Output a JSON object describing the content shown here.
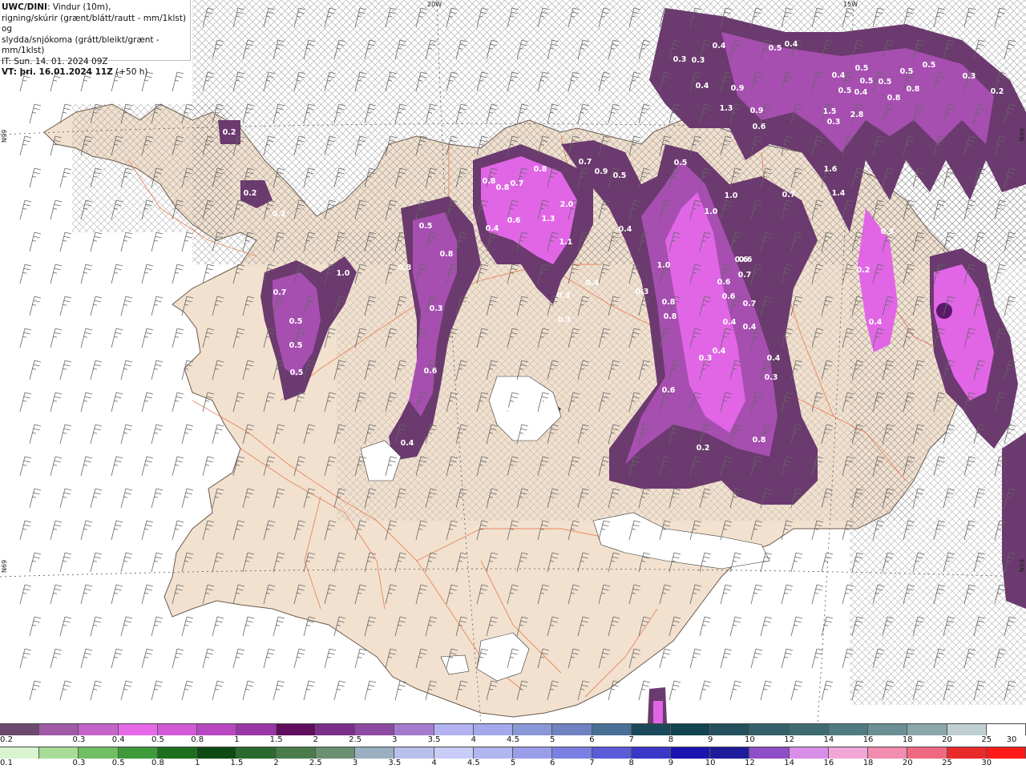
{
  "header": {
    "line1_bold": "UWC/DINI",
    "line1_rest": ": Vindur (10m),",
    "line2": "rigning/skúrir (grænt/blátt/rautt - mm/1klst) og",
    "line3": "slydda/snjókoma (grátt/bleikt/grænt - mm/1klst)",
    "line4": "IT: Sun. 14. 01. 2024 09Z",
    "line5_bold": "VT: þri. 16.01.2024 11Z",
    "line5_rest": " (+50 h)"
  },
  "map": {
    "lon_labels": [
      "20W",
      "15W"
    ],
    "lat_labels": [
      "66N",
      "65N"
    ],
    "side_labels": [
      "N99",
      "N69"
    ],
    "value_labels": [
      "0.2",
      "0.2",
      "0.2",
      "0.7",
      "1.0",
      "0.5",
      "0.5",
      "0.5",
      "0.8",
      "0.3",
      "0.3",
      "0.6",
      "0.4",
      "0.5",
      "0.8",
      "0.8",
      "0.7",
      "0.8",
      "0.6",
      "0.4",
      "1.3",
      "2.0",
      "1.1",
      "0.7",
      "0.9",
      "0.5",
      "0.4",
      "0.4",
      "0.3",
      "0.3",
      "1.0",
      "0.8",
      "0.8",
      "0.6",
      "0.5",
      "1.0",
      "1.0",
      "0.6",
      "0.6",
      "0.7",
      "0.7",
      "0.4",
      "0.4",
      "0.3",
      "0.4",
      "0.3",
      "0.4",
      "0.3",
      "0.6",
      "0.6",
      "0.8",
      "0.2",
      "0.4",
      "0.3",
      "0.3",
      "0.3",
      "0.4",
      "0.4",
      "0.4",
      "0.5",
      "0.4",
      "0.5",
      "0.5",
      "0.5",
      "0.4",
      "0.5",
      "0.5",
      "0.5",
      "0.3",
      "0.8",
      "0.8",
      "0.2",
      "0.9",
      "1.3",
      "0.9",
      "0.6",
      "0.3",
      "1.5",
      "2.8",
      "1.6",
      "1.4",
      "0.7",
      "0.3",
      "0.2",
      "0.4"
    ],
    "colors": {
      "land": "#f2e1cf",
      "sea": "#ffffff",
      "roads": "#e8764a",
      "border": "#d23c3c",
      "snow_dark": "#6b3a6e",
      "snow_mid": "#a64fb0",
      "snow_light": "#e166e6"
    }
  },
  "legend_snow": {
    "labels": [
      "0.2",
      "0.3",
      "0.4",
      "0.5",
      "0.8",
      "1",
      "1.5",
      "2",
      "2.5",
      "3",
      "3.5",
      "4",
      "4.5",
      "5",
      "6",
      "7",
      "8",
      "9",
      "10",
      "12",
      "14",
      "16",
      "18",
      "20",
      "25",
      "30"
    ],
    "colors": [
      "#6b4a6e",
      "#a05aa8",
      "#c463ca",
      "#e66ae8",
      "#d25ad6",
      "#b947c2",
      "#9a36a6",
      "#5e0e5c",
      "#7a2e8a",
      "#8e4aa3",
      "#a57bd0",
      "#b3b3f2",
      "#a3a9ea",
      "#8a98d8",
      "#6f82c2",
      "#4a6f96",
      "#1a4a5a",
      "#0f4450",
      "#244f5c",
      "#34606a",
      "#3e6b72",
      "#4f7b82",
      "#6b8f94",
      "#8aa7aa",
      "#c0d0d2",
      "#ffffff"
    ]
  },
  "legend_rain": {
    "labels": [
      "0.1",
      "0.3",
      "0.5",
      "0.8",
      "1",
      "1.5",
      "2",
      "2.5",
      "3",
      "3.5",
      "4",
      "4.5",
      "5",
      "6",
      "7",
      "8",
      "9",
      "10",
      "12",
      "14",
      "16",
      "18",
      "20",
      "25",
      "30"
    ],
    "colors": [
      "#d8f5d0",
      "#a8dd98",
      "#6fbe64",
      "#3f9a3a",
      "#1d6e1e",
      "#0e4a12",
      "#2a6a2c",
      "#4a7c4a",
      "#6a9070",
      "#9ab0c0",
      "#b8c0ec",
      "#c8ccf6",
      "#b0b6f0",
      "#9a9ee8",
      "#7a80e2",
      "#5a5cd8",
      "#3a38c8",
      "#1a14b0",
      "#1e1c9a",
      "#8e4ec6",
      "#d88ee6",
      "#f2a6d8",
      "#f28cb0",
      "#ef6a80",
      "#e82a2a",
      "#ff1a1a"
    ]
  }
}
